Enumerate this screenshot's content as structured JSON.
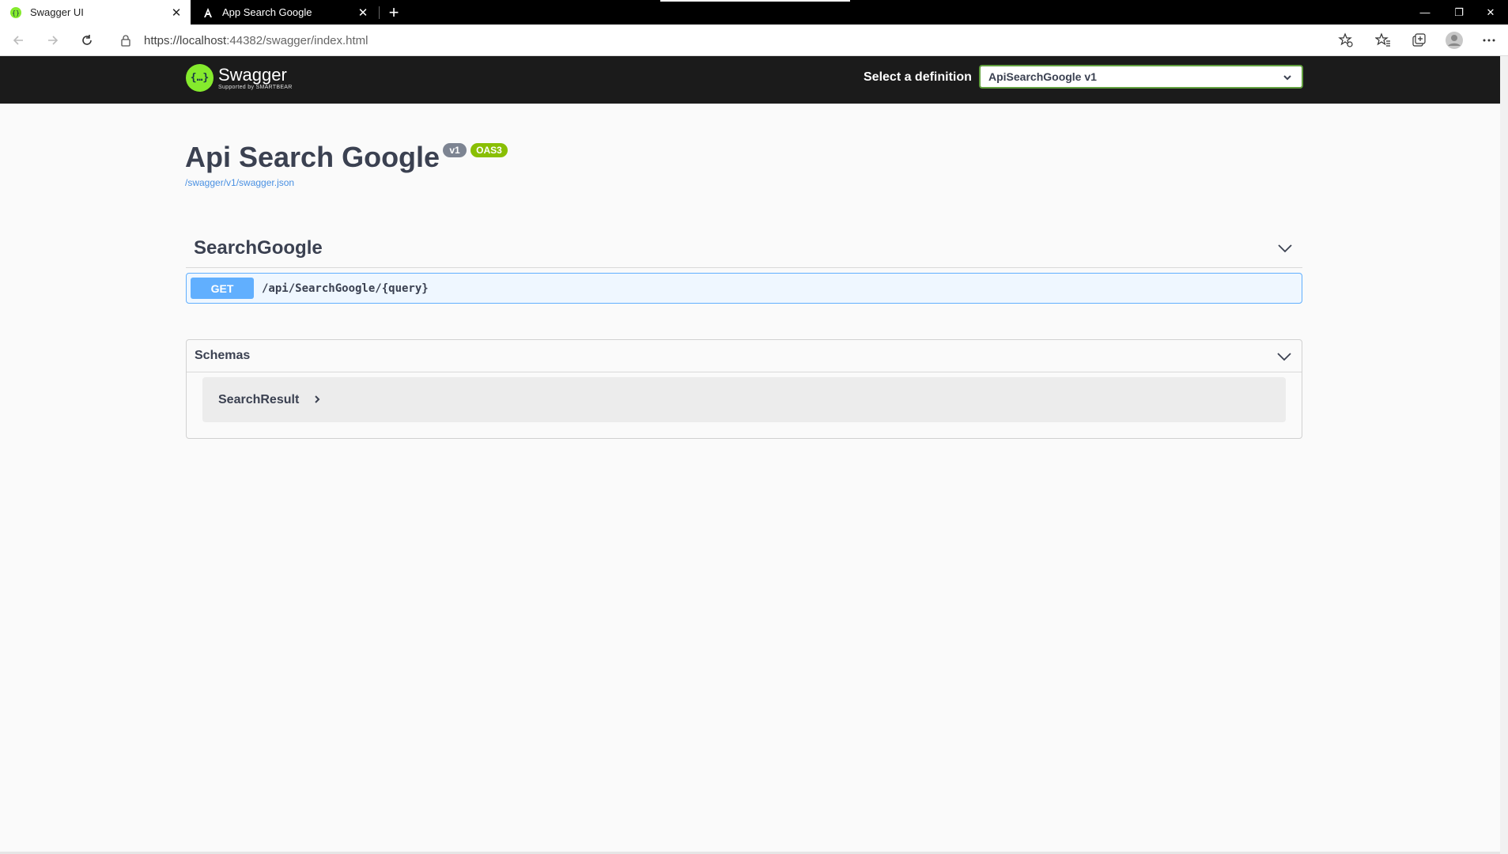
{
  "browser": {
    "tabs": [
      {
        "title": "Swagger UI",
        "active": true,
        "icon": "swagger-favicon"
      },
      {
        "title": "App Search Google",
        "active": false,
        "icon": "angular-favicon"
      }
    ],
    "url_host": "https://localhost",
    "url_rest": ":44382/swagger/index.html"
  },
  "topbar": {
    "logo_text": "Swagger",
    "logo_sub": "Supported by SMARTBEAR",
    "definition_label": "Select a definition",
    "definition_selected": "ApiSearchGoogle v1"
  },
  "info": {
    "title": "Api Search Google",
    "version": "v1",
    "oas": "OAS3",
    "spec_url": "/swagger/v1/swagger.json"
  },
  "tag": {
    "name": "SearchGoogle"
  },
  "operation": {
    "method": "GET",
    "path": "/api/SearchGoogle/{query}"
  },
  "schemas": {
    "title": "Schemas",
    "models": [
      {
        "name": "SearchResult"
      }
    ]
  },
  "colors": {
    "get": "#61affe",
    "swagger_green": "#85ea2d",
    "topbar_bg": "#1b1b1b"
  }
}
